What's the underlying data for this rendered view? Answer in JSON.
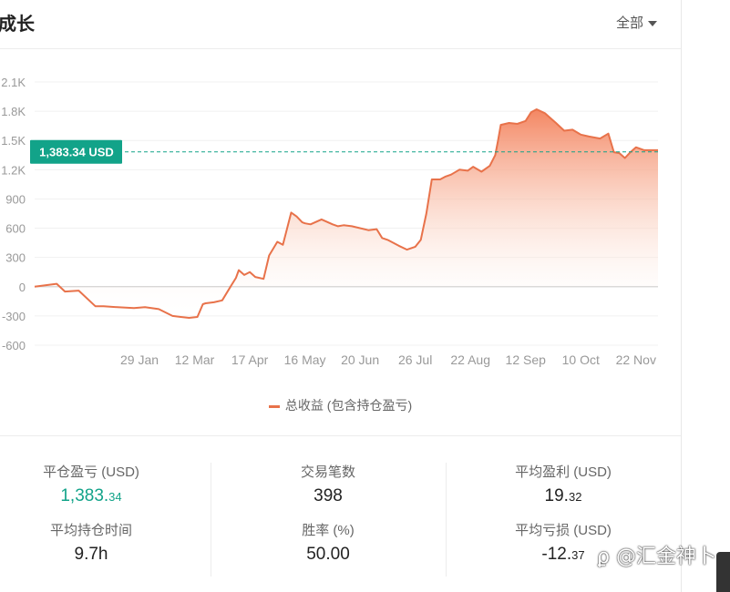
{
  "header": {
    "title": "成长",
    "range_label": "全部"
  },
  "chart_data": {
    "type": "area",
    "title": "",
    "xlabel": "",
    "ylabel": "",
    "ylim": [
      -600,
      2100
    ],
    "yticks": [
      -600,
      -300,
      0,
      300,
      600,
      900,
      1200,
      1500,
      1800,
      2100
    ],
    "ytick_labels": [
      "-600",
      "-300",
      "0",
      "300",
      "600",
      "900",
      "1.2K",
      "1.5K",
      "1.8K",
      "2.1K"
    ],
    "x_tick_labels": [
      "29 Jan",
      "12 Mar",
      "17 Apr",
      "16 May",
      "20 Jun",
      "26 Jul",
      "22 Aug",
      "12 Sep",
      "10 Oct",
      "22 Nov"
    ],
    "x_tick_positions": [
      1,
      2,
      3,
      4,
      5,
      6,
      7,
      8,
      9,
      10
    ],
    "x_range": [
      -0.9,
      10.4
    ],
    "reference_line": {
      "value": 1383.34,
      "label": "1,383.34 USD"
    },
    "series": [
      {
        "name": "总收益 (包含持仓盈亏)",
        "color": "#e8724a",
        "x": [
          -0.9,
          -0.5,
          -0.35,
          -0.1,
          0.2,
          0.35,
          0.6,
          0.9,
          1.1,
          1.35,
          1.6,
          1.75,
          1.9,
          2.05,
          2.15,
          2.2,
          2.35,
          2.5,
          2.65,
          2.75,
          2.8,
          2.9,
          3.0,
          3.1,
          3.25,
          3.35,
          3.5,
          3.6,
          3.75,
          3.85,
          3.95,
          4.0,
          4.1,
          4.3,
          4.5,
          4.6,
          4.7,
          4.85,
          5.15,
          5.3,
          5.4,
          5.5,
          5.7,
          5.85,
          6.0,
          6.1,
          6.2,
          6.3,
          6.45,
          6.55,
          6.65,
          6.8,
          6.95,
          7.05,
          7.2,
          7.35,
          7.45,
          7.5,
          7.55,
          7.7,
          7.85,
          8.0,
          8.1,
          8.2,
          8.35,
          8.55,
          8.7,
          8.85,
          9.0,
          9.15,
          9.35,
          9.5,
          9.6,
          9.7,
          9.8,
          9.9,
          10.0,
          10.15,
          10.25,
          10.4
        ],
        "y": [
          0,
          30,
          -50,
          -40,
          -200,
          -200,
          -210,
          -220,
          -210,
          -230,
          -300,
          -310,
          -320,
          -310,
          -180,
          -170,
          -160,
          -140,
          0,
          90,
          170,
          120,
          150,
          100,
          80,
          320,
          460,
          430,
          760,
          720,
          660,
          650,
          640,
          690,
          640,
          620,
          630,
          620,
          580,
          590,
          500,
          480,
          420,
          380,
          410,
          480,
          750,
          1100,
          1100,
          1130,
          1150,
          1200,
          1190,
          1230,
          1180,
          1240,
          1350,
          1500,
          1660,
          1680,
          1670,
          1700,
          1790,
          1820,
          1780,
          1680,
          1600,
          1610,
          1560,
          1540,
          1520,
          1570,
          1380,
          1370,
          1320,
          1380,
          1430,
          1400,
          1400,
          1400
        ]
      }
    ],
    "grid": true,
    "legend_position": "bottom-center"
  },
  "stats": {
    "closed_pnl": {
      "label": "平仓盈亏 (USD)",
      "int": "1,383.",
      "dec": "34"
    },
    "trades": {
      "label": "交易笔数",
      "value": "398"
    },
    "avg_profit": {
      "label": "平均盈利 (USD)",
      "int": "19.",
      "dec": "32"
    },
    "avg_hold": {
      "label": "平均持仓时间",
      "value": "9.7h"
    },
    "win_rate": {
      "label": "胜率 (%)",
      "value": "50.00"
    },
    "avg_loss": {
      "label": "平均亏损 (USD)",
      "int": "-12.",
      "dec": "37"
    }
  },
  "watermark": {
    "text": "ϼ @汇金神卜"
  }
}
